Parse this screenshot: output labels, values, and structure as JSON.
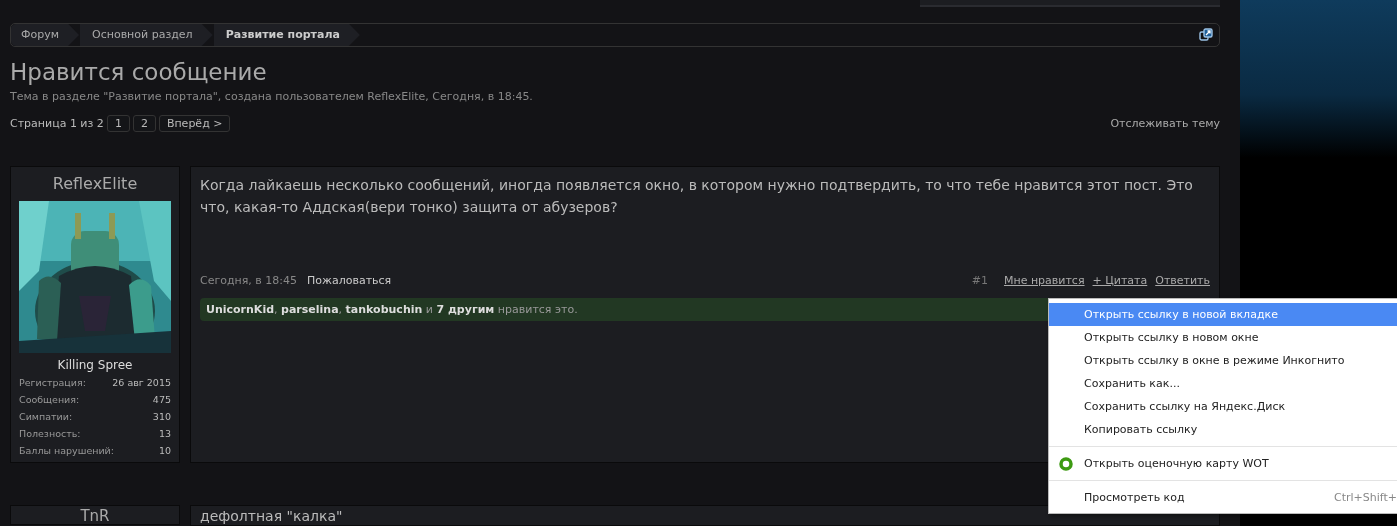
{
  "breadcrumbs": [
    {
      "label": "Форум",
      "current": false
    },
    {
      "label": "Основной раздел",
      "current": false
    },
    {
      "label": "Развитие портала",
      "current": true
    }
  ],
  "thread": {
    "title": "Нравится сообщение",
    "subtitle": "Тема в разделе \"Развитие портала\", создана пользователем ReflexElite, Сегодня, в 18:45.",
    "page_label": "Страница 1 из 2",
    "pages": [
      "1",
      "2"
    ],
    "next": "Вперёд >",
    "watch": "Отслеживать тему"
  },
  "posts": [
    {
      "user": {
        "name": "ReflexElite",
        "title": "Killing Spree",
        "stats": [
          {
            "label": "Регистрация:",
            "value": "26 авг 2015"
          },
          {
            "label": "Сообщения:",
            "value": "475"
          },
          {
            "label": "Симпатии:",
            "value": "310"
          },
          {
            "label": "Полезность:",
            "value": "13"
          },
          {
            "label": "Баллы нарушений:",
            "value": "10"
          }
        ]
      },
      "message": "Когда лайкаешь несколько сообщений, иногда появляется окно, в котором нужно подтвердить, то что тебе нравится этот пост. Это что, какая-то Аддская(вери тонко) защита от абузеров?",
      "date": "Сегодня, в 18:45",
      "report": "Пожаловаться",
      "number": "#1",
      "actions": [
        "Мне нравится",
        "+ Цитата",
        "Ответить"
      ],
      "likes": "**UnicornKid**, **parselina**, **tankobuchin** и **7 другим** нравится это."
    },
    {
      "user": {
        "name": "TnR"
      },
      "message": "дефолтная \"калка\""
    }
  ],
  "context_menu": {
    "items": [
      {
        "label": "Открыть ссылку в новой вкладке",
        "kind": "plain",
        "selected": true,
        "separator_before": false
      },
      {
        "label": "Открыть ссылку в новом окне",
        "kind": "plain",
        "selected": false,
        "separator_before": false
      },
      {
        "label": "Открыть ссылку в окне в режиме Инкогнито",
        "kind": "plain",
        "selected": false,
        "separator_before": false
      },
      {
        "label": "Сохранить как...",
        "kind": "plain",
        "selected": false,
        "separator_before": false
      },
      {
        "label": "Сохранить ссылку на Яндекс.Диск",
        "kind": "plain",
        "selected": false,
        "separator_before": false
      },
      {
        "label": "Копировать ссылку",
        "kind": "plain",
        "selected": false,
        "separator_before": false
      },
      {
        "label": "Открыть оценочную карту WOT",
        "kind": "wot",
        "selected": false,
        "separator_before": true
      },
      {
        "label": "Просмотреть код",
        "kind": "plain",
        "selected": false,
        "separator_before": true,
        "shortcut": "Ctrl+Shift+"
      }
    ]
  }
}
